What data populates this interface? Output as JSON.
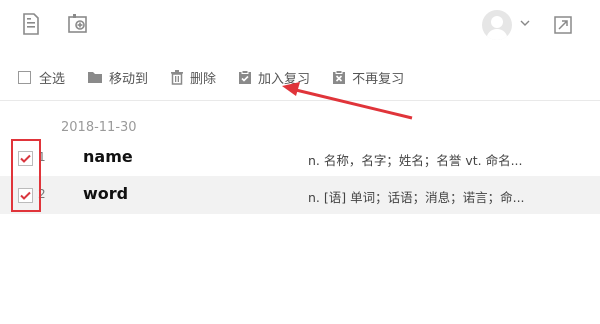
{
  "toolbar": {
    "select_all": "全选",
    "move_to": "移动到",
    "delete": "删除",
    "add_review": "加入复习",
    "no_review": "不再复习"
  },
  "list": {
    "date": "2018-11-30",
    "rows": [
      {
        "index": "1",
        "word": "name",
        "definition": "n. 名称，名字；姓名；名誉  vt. 命名...",
        "checked": true
      },
      {
        "index": "2",
        "word": "word",
        "definition": "n. [语] 单词；话语；消息；诺言；命...",
        "checked": true
      }
    ]
  },
  "icons": {
    "top": [
      "notebook-icon",
      "add-note-icon",
      "avatar",
      "chevron-down-icon",
      "exit-icon"
    ],
    "toolbar": [
      "folder-icon",
      "trash-icon",
      "clipboard-check-icon",
      "clipboard-x-icon"
    ]
  },
  "colors": {
    "annotation_red": "#e0343a",
    "checkbox_red": "#d9363e",
    "selected_row_bg": "#f2f2f2"
  }
}
